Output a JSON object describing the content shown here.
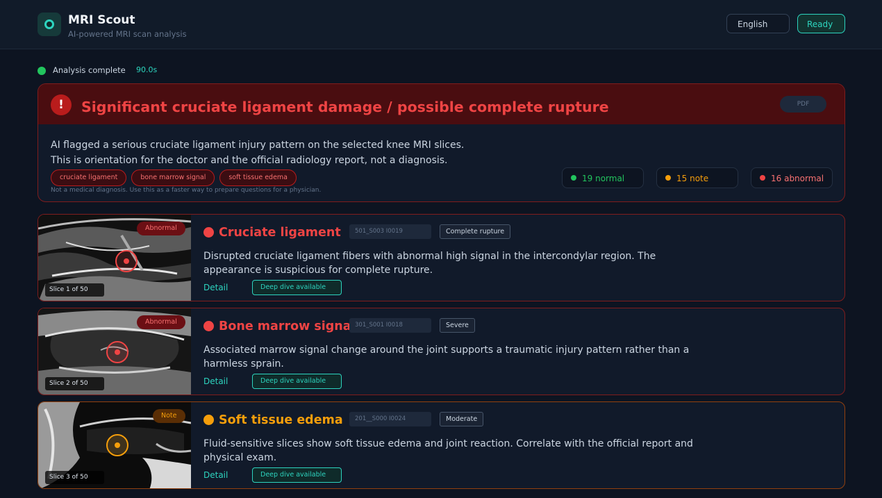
{
  "header": {
    "title": "MRI Scout",
    "subtitle": "AI-powered MRI scan analysis",
    "language": "English",
    "status": "Ready"
  },
  "analysis": {
    "status": "Analysis complete",
    "time": "90.0s"
  },
  "summary": {
    "title": "Significant cruciate ligament damage / possible complete rupture",
    "body": "AI flagged a serious cruciate ligament injury pattern on the selected knee MRI slices. This is orientation for the doctor and the official radiology report, not a diagnosis.",
    "tags": [
      "cruciate ligament",
      "bone marrow signal",
      "soft tissue edema"
    ],
    "disclaimer": "Not a medical diagnosis. Use this as a faster way to prepare questions for a physician.",
    "pdf_label": "PDF",
    "counts": {
      "normal": "19 normal",
      "note": "15 note",
      "abnormal": "16 abnormal"
    }
  },
  "colors": {
    "accent": "#2dd4bf",
    "abnormal": "#ef4444",
    "note": "#f59e0b",
    "normal": "#22c55e"
  },
  "findings": [
    {
      "badge": "Abnormal",
      "slice": "Slice 1 of 50",
      "title": "Cruciate ligament",
      "series": "501_S003 I0019",
      "severity": "Complete rupture",
      "description": "Disrupted cruciate ligament fibers with abnormal high signal in the intercondylar region. The appearance is suspicious for complete rupture.",
      "detail": "Detail",
      "deep_dive": "Deep dive available"
    },
    {
      "badge": "Abnormal",
      "slice": "Slice 2 of 50",
      "title": "Bone marrow signal",
      "series": "301_S001 I0018",
      "severity": "Severe",
      "description": "Associated marrow signal change around the joint supports a traumatic injury pattern rather than a harmless sprain.",
      "detail": "Detail",
      "deep_dive": "Deep dive available"
    },
    {
      "badge": "Note",
      "slice": "Slice 3 of 50",
      "title": "Soft tissue edema",
      "series": "201__S000 I0024",
      "severity": "Moderate",
      "description": "Fluid-sensitive slices show soft tissue edema and joint reaction. Correlate with the official report and physical exam.",
      "detail": "Detail",
      "deep_dive": "Deep dive available"
    }
  ]
}
